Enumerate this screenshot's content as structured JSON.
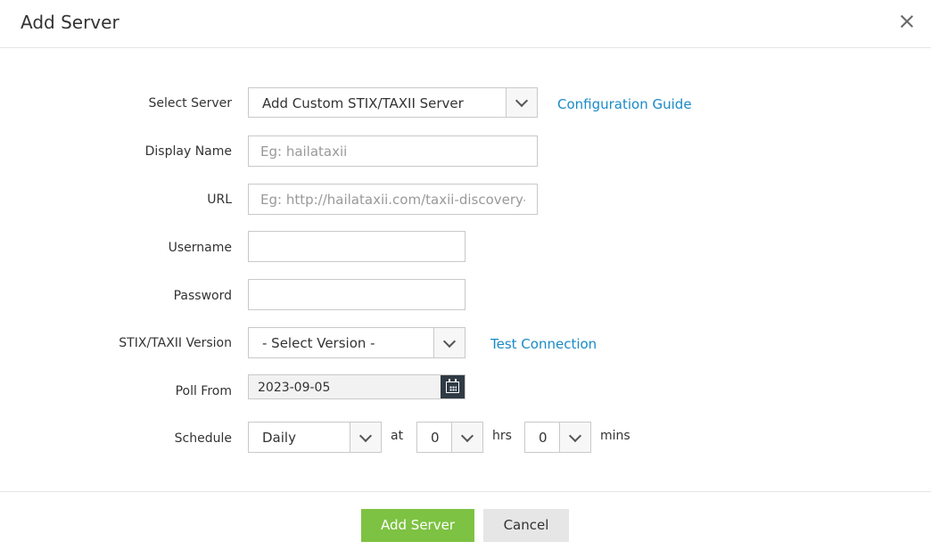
{
  "dialog": {
    "title": "Add Server"
  },
  "form": {
    "select_server": {
      "label": "Select Server",
      "value": "Add Custom STIX/TAXII Server",
      "link": "Configuration Guide"
    },
    "display_name": {
      "label": "Display Name",
      "placeholder": "Eg: hailataxii"
    },
    "url": {
      "label": "URL",
      "placeholder": "Eg: http://hailataxii.com/taxii-discovery-ser"
    },
    "username": {
      "label": "Username",
      "value": ""
    },
    "password": {
      "label": "Password",
      "value": ""
    },
    "version": {
      "label": "STIX/TAXII Version",
      "value": "- Select Version -",
      "link": "Test Connection"
    },
    "poll_from": {
      "label": "Poll From",
      "value": "2023-09-05"
    },
    "schedule": {
      "label": "Schedule",
      "frequency": "Daily",
      "at_label": "at",
      "hours": "0",
      "hrs_label": "hrs",
      "minutes": "0",
      "mins_label": "mins"
    }
  },
  "footer": {
    "primary_label": "Add Server",
    "cancel_label": "Cancel"
  },
  "colors": {
    "accent_link": "#1a8ac6",
    "primary_button": "#7dc242",
    "calendar_button": "#2f3a44"
  }
}
